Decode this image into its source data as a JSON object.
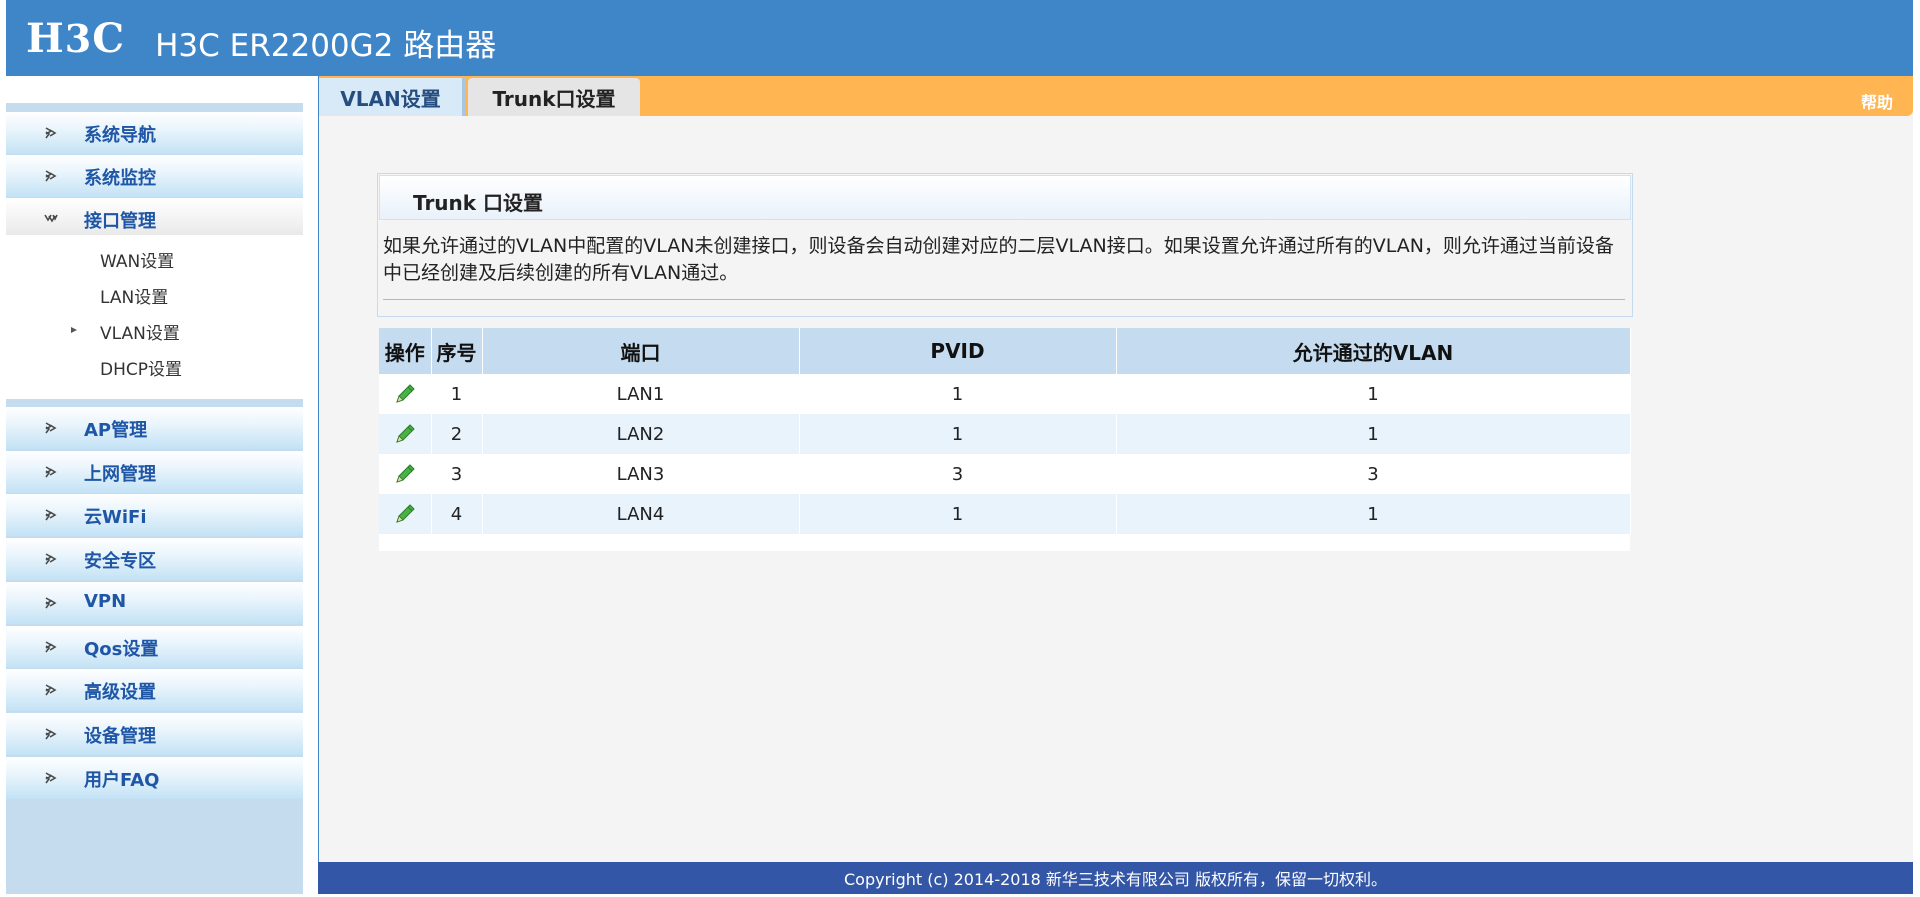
{
  "header": {
    "logo_h": "H",
    "logo_3": "3",
    "logo_c": "C",
    "product": "H3C ER2200G2 路由器"
  },
  "sidebar": {
    "items": [
      {
        "label": "系统导航",
        "icon": "arrow-right-icon"
      },
      {
        "label": "系统监控",
        "icon": "arrow-right-icon"
      },
      {
        "label": "接口管理",
        "icon": "arrow-down-icon"
      },
      {
        "label": "AP管理",
        "icon": "arrow-right-icon"
      },
      {
        "label": "上网管理",
        "icon": "arrow-right-icon"
      },
      {
        "label": "云WiFi",
        "icon": "arrow-right-icon"
      },
      {
        "label": "安全专区",
        "icon": "arrow-right-icon"
      },
      {
        "label": "VPN",
        "icon": "arrow-right-icon"
      },
      {
        "label": "Qos设置",
        "icon": "arrow-right-icon"
      },
      {
        "label": "高级设置",
        "icon": "arrow-right-icon"
      },
      {
        "label": "设备管理",
        "icon": "arrow-right-icon"
      },
      {
        "label": "用户FAQ",
        "icon": "arrow-right-icon"
      }
    ],
    "subitems": [
      {
        "label": "WAN设置"
      },
      {
        "label": "LAN设置"
      },
      {
        "label": "VLAN设置"
      },
      {
        "label": "DHCP设置"
      }
    ]
  },
  "tabs": {
    "vlan": "VLAN设置",
    "trunk": "Trunk口设置",
    "help": "帮助"
  },
  "section": {
    "title": "Trunk 口设置",
    "description": "如果允许通过的VLAN中配置的VLAN未创建接口，则设备会自动创建对应的二层VLAN接口。如果设置允许通过所有的VLAN，则允许通过当前设备中已经创建及后续创建的所有VLAN通过。"
  },
  "table": {
    "headers": [
      "操作",
      "序号",
      "端口",
      "PVID",
      "允许通过的VLAN"
    ],
    "rows": [
      {
        "index": "1",
        "port": "LAN1",
        "pvid": "1",
        "vlan": "1"
      },
      {
        "index": "2",
        "port": "LAN2",
        "pvid": "1",
        "vlan": "1"
      },
      {
        "index": "3",
        "port": "LAN3",
        "pvid": "3",
        "vlan": "3"
      },
      {
        "index": "4",
        "port": "LAN4",
        "pvid": "1",
        "vlan": "1"
      }
    ]
  },
  "footer": {
    "copyright": "Copyright (c) 2014-2018 新华三技术有限公司 版权所有，保留一切权利。"
  },
  "colors": {
    "header_blue": "#3f86c9",
    "tab_orange": "#ffb652",
    "footer_blue": "#3357a6",
    "nav_text": "#1f56a6"
  }
}
